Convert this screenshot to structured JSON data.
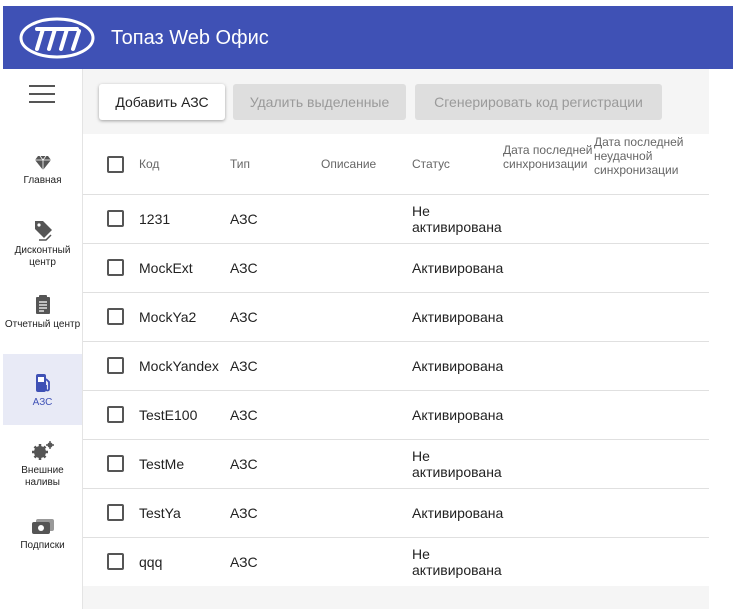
{
  "app": {
    "title": "Топаз Web Офис"
  },
  "sidebar": {
    "items": [
      {
        "label": "Главная",
        "icon": "diamond-icon"
      },
      {
        "label": "Дисконтный центр",
        "icon": "tag-icon"
      },
      {
        "label": "Отчетный центр",
        "icon": "report-icon"
      },
      {
        "label": "АЗС",
        "icon": "fuel-pump-icon",
        "active": true
      },
      {
        "label": "Внешние наливы",
        "icon": "gears-icon"
      },
      {
        "label": "Подписки",
        "icon": "subscription-icon"
      }
    ]
  },
  "toolbar": {
    "add_label": "Добавить АЗС",
    "delete_label": "Удалить выделенные",
    "generate_label": "Сгенерировать код регистрации"
  },
  "table": {
    "columns": {
      "code": "Код",
      "type": "Тип",
      "description": "Описание",
      "status": "Статус",
      "last_sync": "Дата последней синхронизации",
      "last_failed_sync": "Дата последней неудачной синхронизации"
    },
    "rows": [
      {
        "code": "1231",
        "type": "АЗС",
        "description": "",
        "status": "Не активирована"
      },
      {
        "code": "MockExt",
        "type": "АЗС",
        "description": "",
        "status": "Активирована"
      },
      {
        "code": "MockYa2",
        "type": "АЗС",
        "description": "",
        "status": "Активирована"
      },
      {
        "code": "MockYandex",
        "type": "АЗС",
        "description": "",
        "status": "Активирована"
      },
      {
        "code": "TestE100",
        "type": "АЗС",
        "description": "",
        "status": "Активирована"
      },
      {
        "code": "TestMe",
        "type": "АЗС",
        "description": "",
        "status": "Не активирована"
      },
      {
        "code": "TestYa",
        "type": "АЗС",
        "description": "",
        "status": "Активирована"
      },
      {
        "code": "qqq",
        "type": "АЗС",
        "description": "",
        "status": "Не активирована"
      }
    ]
  },
  "colors": {
    "header": "#3f51b5",
    "active_nav_bg": "#e8eaf6",
    "active_nav_text": "#3f51b5"
  }
}
